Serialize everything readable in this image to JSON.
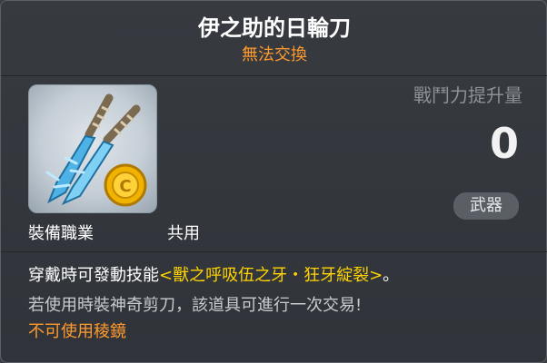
{
  "item": {
    "name": "伊之助的日輪刀",
    "trade_status": "無法交換"
  },
  "stats": {
    "combat_power_label": "戰鬥力提升量",
    "combat_power_value": "0",
    "category_badge": "武器"
  },
  "requirements": {
    "job_label": "裝備職業",
    "job_value": "共用"
  },
  "description": {
    "line1_prefix": "穿戴時可發動技能",
    "line1_skill": "<獸之呼吸伍之牙・狂牙綻裂>",
    "line1_suffix": "。",
    "line2": "若使用時裝神奇剪刀，該道具可進行一次交易!",
    "line3": "不可使用稜鏡"
  },
  "colors": {
    "title": "#ffffff",
    "orange": "#ff9a2e",
    "skill_highlight": "#ffd400",
    "background": "#33373c"
  },
  "icons": {
    "item_icon": "dual-blue-swords-with-gold-coin-icon"
  }
}
